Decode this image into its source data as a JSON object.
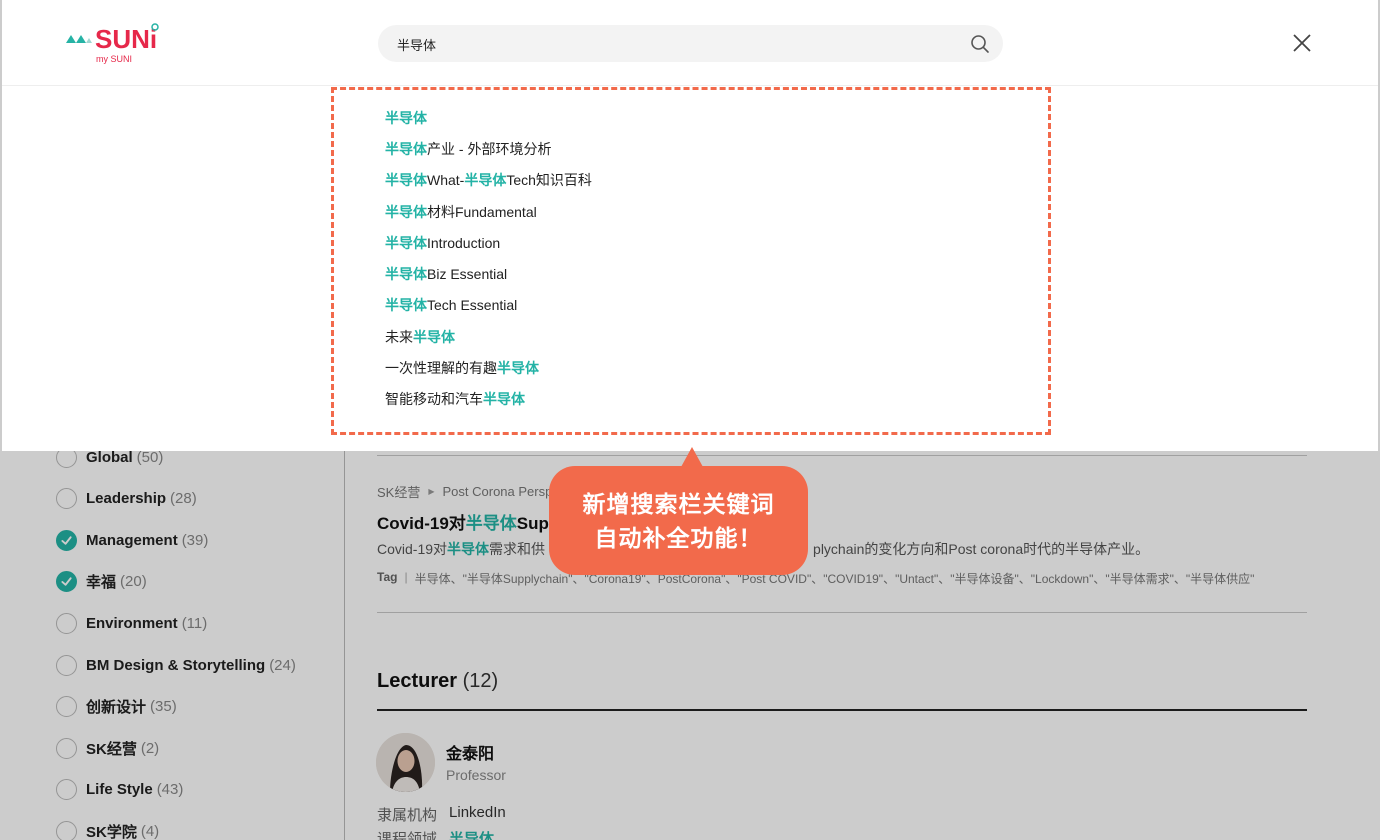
{
  "search": {
    "query": "半导体",
    "suggestions": [
      [
        "半导体",
        ""
      ],
      [
        "半导体",
        "产业 - 外部环境分析"
      ],
      [
        "半导体",
        "What-",
        "半导体",
        "Tech知识百科"
      ],
      [
        "半导体",
        "材料Fundamental"
      ],
      [
        "半导体",
        "Introduction"
      ],
      [
        "半导体",
        "Biz Essential"
      ],
      [
        "半导体",
        "Tech Essential"
      ],
      [
        "未来",
        "半导体"
      ],
      [
        "一次性理解的有趣",
        "半导体"
      ],
      [
        "智能移动和汽车",
        "半导体"
      ]
    ]
  },
  "logo": {
    "brand": "SUNi",
    "sub": "my SUNI"
  },
  "callout": {
    "line1": "新增搜索栏关键词",
    "line2": "自动补全功能！"
  },
  "filters": [
    {
      "label": "Global",
      "count": "(50)",
      "checked": false
    },
    {
      "label": "Leadership",
      "count": "(28)",
      "checked": false
    },
    {
      "label": "Management",
      "count": "(39)",
      "checked": true
    },
    {
      "label": "幸福",
      "count": "(20)",
      "checked": true
    },
    {
      "label": "Environment",
      "count": "(11)",
      "checked": false
    },
    {
      "label": "BM Design & Storytelling",
      "count": "(24)",
      "checked": false
    },
    {
      "label": "创新设计",
      "count": "(35)",
      "checked": false
    },
    {
      "label": "SK经营",
      "count": "(2)",
      "checked": false
    },
    {
      "label": "Life Style",
      "count": "(43)",
      "checked": false
    },
    {
      "label": "SK学院",
      "count": "(4)",
      "checked": false
    }
  ],
  "result": {
    "crumb1": "SK经营",
    "crumb2": "Post Corona Persp",
    "title_prefix": "Covid-19对",
    "title_match": "半导体",
    "title_suffix": "Supp",
    "desc_prefix": "Covid-19对",
    "desc_match": "半导体",
    "desc_mid": "需求和供",
    "desc_tail": "plychain的变化方向和Post corona时代的半导体产业。",
    "tag_label": "Tag",
    "tags": "半导体、\"半导体Supplychain\"、\"Corona19\"、PostCorona\"、\"Post COVID\"、\"COVID19\"、\"Untact\"、\"半导体设备\"、\"Lockdown\"、\"半导体需求\"、\"半导体供应\""
  },
  "lecturer": {
    "heading": "Lecturer",
    "count": "(12)",
    "name": "金泰阳",
    "role": "Professor",
    "org_key": "隶属机构",
    "org_val": "LinkedIn",
    "field_key": "课程领域",
    "field_val": "半导体"
  },
  "colors": {
    "accent": "#24b3a6",
    "callout": "#f26a4b",
    "brand": "#e6284a"
  },
  "icons": {
    "search": "search-icon",
    "close": "close-icon",
    "check": "check-icon"
  }
}
